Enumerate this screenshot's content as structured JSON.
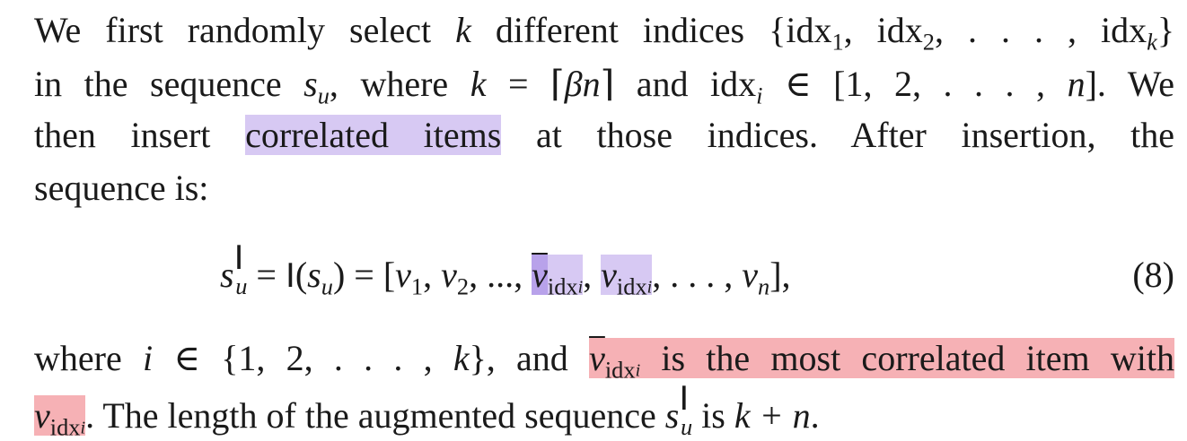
{
  "paragraph": {
    "l1_t1": "We first randomly select ",
    "l1_k": "k",
    "l1_t2": " different indices {idx",
    "l1_s1": "1",
    "l1_t3": ", idx",
    "l1_s2": "2",
    "l1_t4": ", . . . , idx",
    "l1_sk": "k",
    "l1_t5": "}",
    "l2_t1": "in the sequence ",
    "l2_s": "s",
    "l2_u": "u",
    "l2_t2": ", where ",
    "l2_k": "k",
    "l2_t3": " = ⌈",
    "l2_beta": "βn",
    "l2_t4": "⌉ and idx",
    "l2_i": "i",
    "l2_t5": " ∈ [1, 2, . . . , ",
    "l2_n": "n",
    "l2_t6": "]. We",
    "l3_t1": "then insert ",
    "l3_hl": "correlated items",
    "l3_t2": " at those indices. After insertion, the",
    "l4_t1": "sequence is:"
  },
  "equation": {
    "lhs_s": "s",
    "lhs_u": "u",
    "lhs_sup": "I",
    "eq1": " = ",
    "I": "I",
    "paren_open": "(",
    "mid_s": "s",
    "mid_u": "u",
    "paren_close": ")",
    "eq2": " = [",
    "v1": "v",
    "v1_sub": "1",
    "comma1": ", ",
    "v2": "v",
    "v2_sub": "2",
    "dots1": ", ..., ",
    "vbar": "v",
    "vbar_sub": "idx",
    "vbar_subsub": "i",
    "comma2": ", ",
    "vidx": "v",
    "vidx_sub": "idx",
    "vidx_subsub": "i",
    "dots2": ", . . . , ",
    "vn": "v",
    "vn_sub": "n",
    "close": "],",
    "number": "(8)"
  },
  "after": {
    "l5_t1": "where ",
    "l5_i": "i",
    "l5_t2": " ∈ {1, 2, . . . , ",
    "l5_k": "k",
    "l5_t3": "}, and ",
    "l5_v": "v",
    "l5_sub": "idx",
    "l5_subsub": "i",
    "l5_t4": " is the most correlated item with",
    "l6_v": "v",
    "l6_sub": "idx",
    "l6_subsub": "i",
    "l6_t1": ". The length of the augmented sequence ",
    "l6_s": "s",
    "l6_u": "u",
    "l6_sup": "I",
    "l6_t2": " is ",
    "l6_kn": "k + n",
    "l6_t3": "."
  }
}
